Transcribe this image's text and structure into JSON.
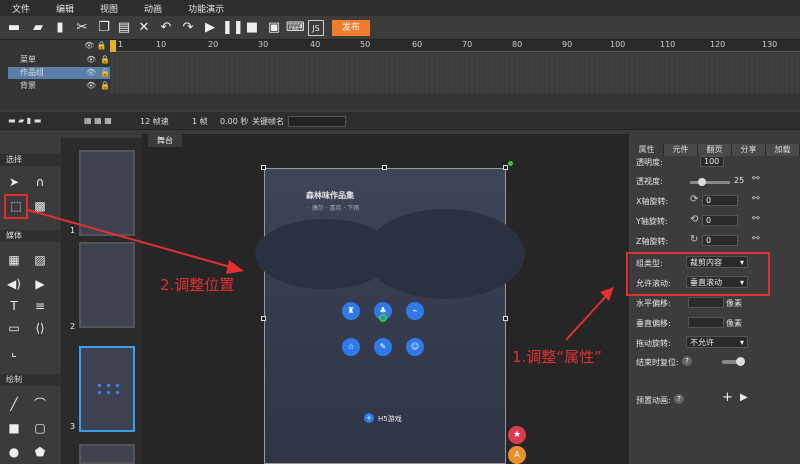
{
  "menu": [
    "文件",
    "编辑",
    "视图",
    "动画",
    "功能演示"
  ],
  "toolbar": {
    "publish": "发布",
    "icons": [
      "new-file",
      "open-file",
      "save-file",
      "cut",
      "copy",
      "paste",
      "delete",
      "undo",
      "redo",
      "play",
      "pause",
      "stop-frame",
      "fullscreen",
      "code",
      "js-file"
    ]
  },
  "timeline": {
    "ticks": [
      "1",
      "10",
      "20",
      "30",
      "40",
      "50",
      "60",
      "70",
      "80",
      "90",
      "100",
      "110",
      "120",
      "130"
    ],
    "layers": [
      {
        "name": "菜单",
        "eye": "👁",
        "lock": "🔒"
      },
      {
        "name": "作品组",
        "eye": "👁",
        "lock": "🔒"
      },
      {
        "name": "背景",
        "eye": "👁",
        "lock": "🔒"
      }
    ],
    "info": {
      "fps": "12 帧速",
      "frame": "1 帧",
      "time": "0.00 秒",
      "keyframe_label": "关键帧名"
    }
  },
  "left": {
    "sec_select": "选择",
    "sec_media": "媒体",
    "sec_draw": "绘制"
  },
  "thumbs": {
    "n1": "1",
    "n2": "2",
    "n3": "3"
  },
  "stage": {
    "tab": "舞台",
    "title": "森林味作品集",
    "subtitle": "· 偶尔 · 喜欢 · 下雨",
    "h5": "H5游戏"
  },
  "annotations": {
    "left": "2.调整位置",
    "right": "1.调整“属性”"
  },
  "props": {
    "tabs": [
      "属性",
      "元件",
      "翻页",
      "分享",
      "加载"
    ],
    "opacity_label": "透明度:",
    "opacity_value": "100",
    "perspective_label": "透视度:",
    "perspective_value": "25",
    "xrot_label": "X轴旋转:",
    "xrot_value": "0",
    "yrot_label": "Y轴旋转:",
    "yrot_value": "0",
    "zrot_label": "Z轴旋转:",
    "zrot_value": "0",
    "group_type_label": "组类型:",
    "group_type_value": "裁剪内容",
    "scroll_label": "允许滚动:",
    "scroll_value": "垂直滚动",
    "hoffset_label": "水平偏移:",
    "hoffset_unit": "像素",
    "voffset_label": "垂直偏移:",
    "voffset_unit": "像素",
    "drag_label": "拖动旋转:",
    "drag_value": "不允许",
    "reset_label": "结束时复位:",
    "preset_label": "预置动画:"
  }
}
